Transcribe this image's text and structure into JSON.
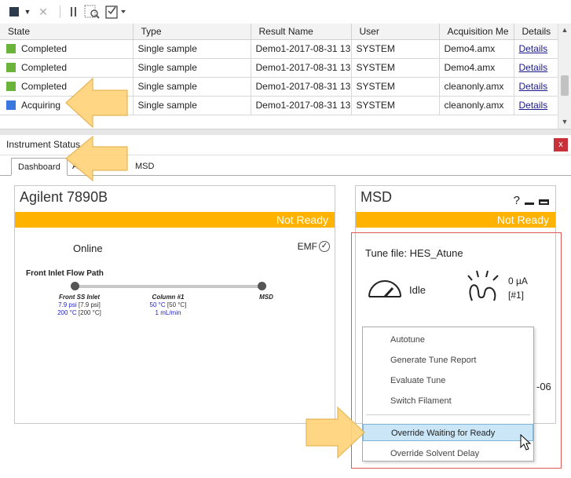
{
  "toolbar": {
    "items": [
      {
        "name": "stop-icon",
        "glyph": "■"
      },
      {
        "name": "dropdown-caret-icon",
        "glyph": "▾"
      },
      {
        "name": "abort-icon",
        "glyph": "✕"
      },
      {
        "name": "pause-icon",
        "glyph": "⏸"
      },
      {
        "name": "find-icon",
        "glyph": "⌕"
      },
      {
        "name": "checklist-icon",
        "glyph": "☑"
      }
    ]
  },
  "grid": {
    "columns": [
      "State",
      "Type",
      "Result Name",
      "User",
      "Acquisition Me",
      "Details"
    ],
    "rows": [
      {
        "state": "Completed",
        "state_color": "#6ab43c",
        "type": "Single sample",
        "result": "Demo1-2017-08-31 13...",
        "user": "SYSTEM",
        "method": "Demo4.amx",
        "details": "Details"
      },
      {
        "state": "Completed",
        "state_color": "#6ab43c",
        "type": "Single sample",
        "result": "Demo1-2017-08-31 13...",
        "user": "SYSTEM",
        "method": "Demo4.amx",
        "details": "Details"
      },
      {
        "state": "Completed",
        "state_color": "#6ab43c",
        "type": "Single sample",
        "result": "Demo1-2017-08-31 13...",
        "user": "SYSTEM",
        "method": "cleanonly.amx",
        "details": "Details"
      },
      {
        "state": "Acquiring",
        "state_color": "#3a78e0",
        "type": "Single sample",
        "result": "Demo1-2017-08-31 13...",
        "user": "SYSTEM",
        "method": "cleanonly.amx",
        "details": "Details"
      }
    ]
  },
  "panel": {
    "title": "Instrument Status",
    "close": "x",
    "tabs": [
      "Dashboard",
      "A",
      "MSD"
    ]
  },
  "gc": {
    "title": "Agilent 7890B",
    "status": "Not Ready",
    "online": "Online",
    "emf": "EMF",
    "flow_title": "Front Inlet Flow Path",
    "nodes": [
      {
        "label": "Front SS Inlet",
        "line1_val": "7.9 psi",
        "line1_set": "[7.9 psi]",
        "line2_val": "200 °C",
        "line2_set": "[200 °C]"
      },
      {
        "label": "Column #1",
        "line1_val": "50 °C",
        "line1_set": "[50 °C]",
        "line2_val": "1 mL/min",
        "line2_set": ""
      },
      {
        "label": "MSD",
        "line1_val": "",
        "line1_set": "",
        "line2_val": "",
        "line2_set": ""
      }
    ]
  },
  "msd": {
    "title": "MSD",
    "status": "Not Ready",
    "help": "?",
    "tune_label": "Tune file:",
    "tune_file": "HES_Atune",
    "vacuum": "Idle",
    "emission": "0 µA",
    "filament": "[#1]",
    "trailing": "-06"
  },
  "context_menu": {
    "items": [
      "Autotune",
      "Generate Tune Report",
      "Evaluate Tune",
      "Switch Filament",
      "Override Waiting for Ready",
      "Override Solvent Delay"
    ],
    "highlighted": "Override Waiting for Ready"
  },
  "colors": {
    "status_bar": "#ffb300",
    "annotation_arrow": "#ffd37a",
    "annotation_rect": "#e05757"
  }
}
